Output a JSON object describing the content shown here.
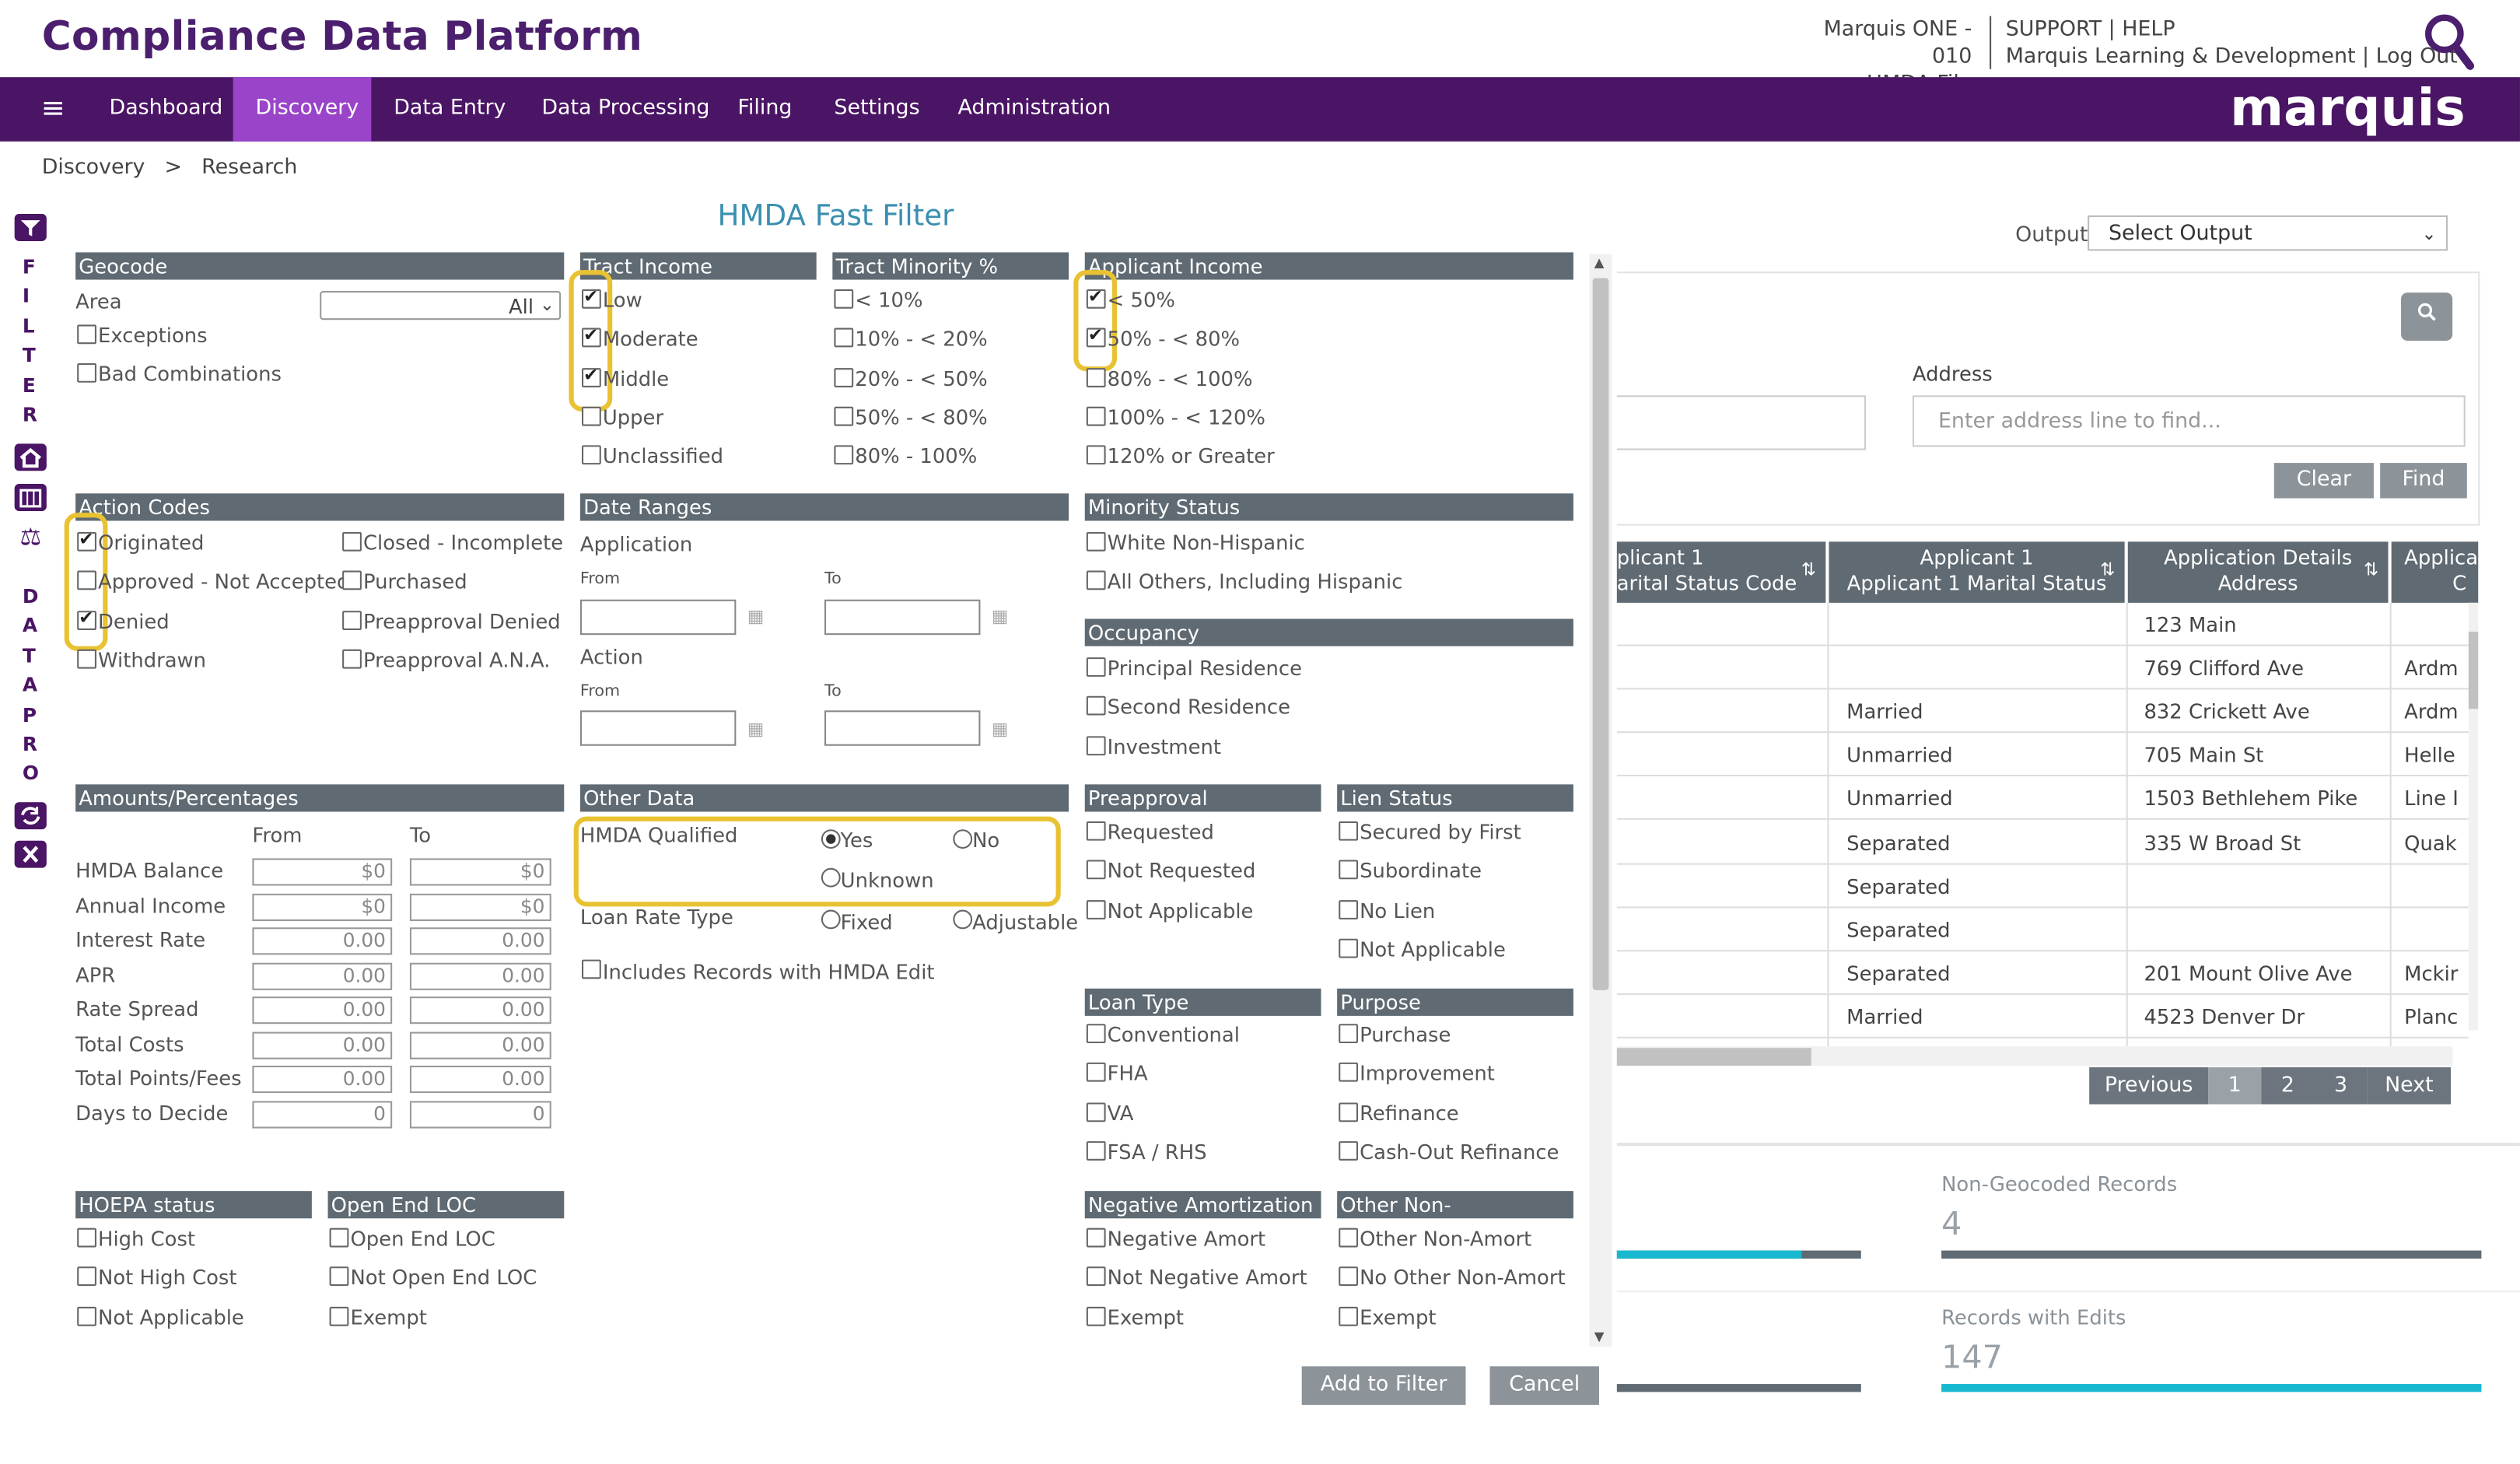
{
  "header": {
    "app_title": "Compliance Data Platform",
    "account_line1": "Marquis ONE - 010",
    "account_line2": "HMDA File",
    "links_line1": "SUPPORT | HELP",
    "links_line2": "Marquis Learning & Development | Log Out",
    "brand": "marquis"
  },
  "nav": {
    "menu_icon": "hamburger-icon",
    "items": [
      "Dashboard",
      "Discovery",
      "Data Entry",
      "Data Processing",
      "Filing",
      "Settings",
      "Administration"
    ],
    "active": "Discovery"
  },
  "breadcrumb": {
    "parent": "Discovery",
    "sep": ">",
    "current": "Research"
  },
  "sidebar": {
    "filter_letters": [
      "F",
      "I",
      "L",
      "T",
      "E",
      "R"
    ],
    "datapro_letters": [
      "D",
      "A",
      "T",
      "A",
      "P",
      "R",
      "O"
    ],
    "icons": [
      "filter-icon",
      "home-icon",
      "building-icon",
      "scales-icon",
      "refresh-icon",
      "close-icon"
    ]
  },
  "filter": {
    "title": "HMDA Fast Filter",
    "geocode": {
      "title": "Geocode",
      "area_label": "Area",
      "area_value": "All",
      "options": [
        "Exceptions",
        "Bad Combinations"
      ]
    },
    "tract_income": {
      "title": "Tract Income",
      "options": [
        "Low",
        "Moderate",
        "Middle",
        "Upper",
        "Unclassified"
      ],
      "checked": [
        true,
        true,
        true,
        false,
        false
      ]
    },
    "tract_minority": {
      "title": "Tract Minority %",
      "options": [
        "< 10%",
        "10% - < 20%",
        "20% - < 50%",
        "50% - < 80%",
        "80% - 100%"
      ]
    },
    "applicant_income": {
      "title": "Applicant Income",
      "options": [
        "< 50%",
        "50% - < 80%",
        "80% - < 100%",
        "100% - < 120%",
        "120% or Greater"
      ],
      "checked": [
        true,
        true,
        false,
        false,
        false
      ]
    },
    "action_codes": {
      "title": "Action Codes",
      "col1": [
        "Originated",
        "Approved - Not Accepted",
        "Denied",
        "Withdrawn"
      ],
      "col1_checked": [
        true,
        false,
        true,
        false
      ],
      "col2": [
        "Closed - Incomplete",
        "Purchased",
        "Preapproval Denied",
        "Preapproval A.N.A."
      ]
    },
    "date_ranges": {
      "title": "Date Ranges",
      "application": "Application",
      "action": "Action",
      "from": "From",
      "to": "To"
    },
    "minority_status": {
      "title": "Minority Status",
      "options": [
        "White Non-Hispanic",
        "All Others, Including Hispanic"
      ]
    },
    "occupancy": {
      "title": "Occupancy",
      "options": [
        "Principal Residence",
        "Second Residence",
        "Investment"
      ]
    },
    "amounts": {
      "title": "Amounts/Percentages",
      "from": "From",
      "to": "To",
      "rows": [
        {
          "label": "HMDA Balance",
          "from": "$0",
          "to": "$0"
        },
        {
          "label": "Annual Income",
          "from": "$0",
          "to": "$0"
        },
        {
          "label": "Interest Rate",
          "from": "0.00",
          "to": "0.00"
        },
        {
          "label": "APR",
          "from": "0.00",
          "to": "0.00"
        },
        {
          "label": "Rate Spread",
          "from": "0.00",
          "to": "0.00"
        },
        {
          "label": "Total Costs",
          "from": "0.00",
          "to": "0.00"
        },
        {
          "label": "Total Points/Fees",
          "from": "0.00",
          "to": "0.00"
        },
        {
          "label": "Days to Decide",
          "from": "0",
          "to": "0"
        }
      ]
    },
    "other_data": {
      "title": "Other Data",
      "hmda_qualified": "HMDA Qualified",
      "yes": "Yes",
      "no": "No",
      "unknown": "Unknown",
      "selected": "Yes",
      "loan_rate_type": "Loan Rate Type",
      "fixed": "Fixed",
      "adjustable": "Adjustable",
      "includes_edit": "Includes Records with HMDA Edit"
    },
    "preapproval": {
      "title": "Preapproval",
      "options": [
        "Requested",
        "Not Requested",
        "Not Applicable"
      ]
    },
    "lien_status": {
      "title": "Lien Status",
      "options": [
        "Secured by First",
        "Subordinate",
        "No Lien",
        "Not Applicable"
      ]
    },
    "loan_type": {
      "title": "Loan Type",
      "options": [
        "Conventional",
        "FHA",
        "VA",
        "FSA / RHS"
      ]
    },
    "purpose": {
      "title": "Purpose",
      "options": [
        "Purchase",
        "Improvement",
        "Refinance",
        "Cash-Out Refinance"
      ]
    },
    "hoepa": {
      "title": "HOEPA status",
      "options": [
        "High Cost",
        "Not High Cost",
        "Not Applicable"
      ]
    },
    "open_end": {
      "title": "Open End LOC",
      "options": [
        "Open End LOC",
        "Not Open End LOC",
        "Exempt"
      ]
    },
    "neg_amort": {
      "title": "Negative Amortization",
      "options": [
        "Negative Amort",
        "Not Negative Amort",
        "Exempt"
      ]
    },
    "other_non_amort": {
      "title": "Other Non-Amortization",
      "options": [
        "Other Non-Amort",
        "No Other Non-Amort",
        "Exempt"
      ]
    },
    "buttons": {
      "add": "Add to Filter",
      "cancel": "Cancel"
    }
  },
  "right": {
    "output_label": "Output",
    "output_value": "Select Output",
    "address_label": "Address",
    "address_placeholder": "Enter address line to find...",
    "clear": "Clear",
    "find": "Find",
    "columns": [
      {
        "l1": "plicant 1",
        "l2": "arital Status Code"
      },
      {
        "l1": "Applicant 1",
        "l2": "Applicant 1 Marital Status"
      },
      {
        "l1": "Application Details",
        "l2": "Address"
      },
      {
        "l1": "Applica",
        "l2": "C"
      }
    ],
    "rows": [
      {
        "status": "",
        "address": "123 Main",
        "city": ""
      },
      {
        "status": "",
        "address": "769 Clifford Ave",
        "city": "Ardm"
      },
      {
        "status": "Married",
        "address": "832 Crickett Ave",
        "city": "Ardm"
      },
      {
        "status": "Unmarried",
        "address": "705 Main St",
        "city": "Helle"
      },
      {
        "status": "Unmarried",
        "address": "1503 Bethlehem Pike",
        "city": "Line I"
      },
      {
        "status": "Separated",
        "address": "335 W Broad St",
        "city": "Quak"
      },
      {
        "status": "Separated",
        "address": "",
        "city": ""
      },
      {
        "status": "Separated",
        "address": "",
        "city": ""
      },
      {
        "status": "Separated",
        "address": "201 Mount Olive Ave",
        "city": "Mckir"
      },
      {
        "status": "Married",
        "address": "4523 Denver Dr",
        "city": "Planc"
      }
    ],
    "pagination": {
      "previous": "Previous",
      "pages": [
        "1",
        "2",
        "3"
      ],
      "next": "Next",
      "current": "1"
    },
    "stats": [
      {
        "label": "Non-Geocoded Records",
        "value": "4",
        "bar_fraction": 1.0
      },
      {
        "label": "Records with Edits",
        "value": "147",
        "bar_fraction": 1.0
      }
    ]
  },
  "colors": {
    "nav_bg": "#4a1565",
    "nav_active": "#9a44c9",
    "section_header": "#5f6a72",
    "highlight": "#e8c232",
    "title_blue": "#3a8fb0",
    "stat_bar": "#17b8d0"
  }
}
